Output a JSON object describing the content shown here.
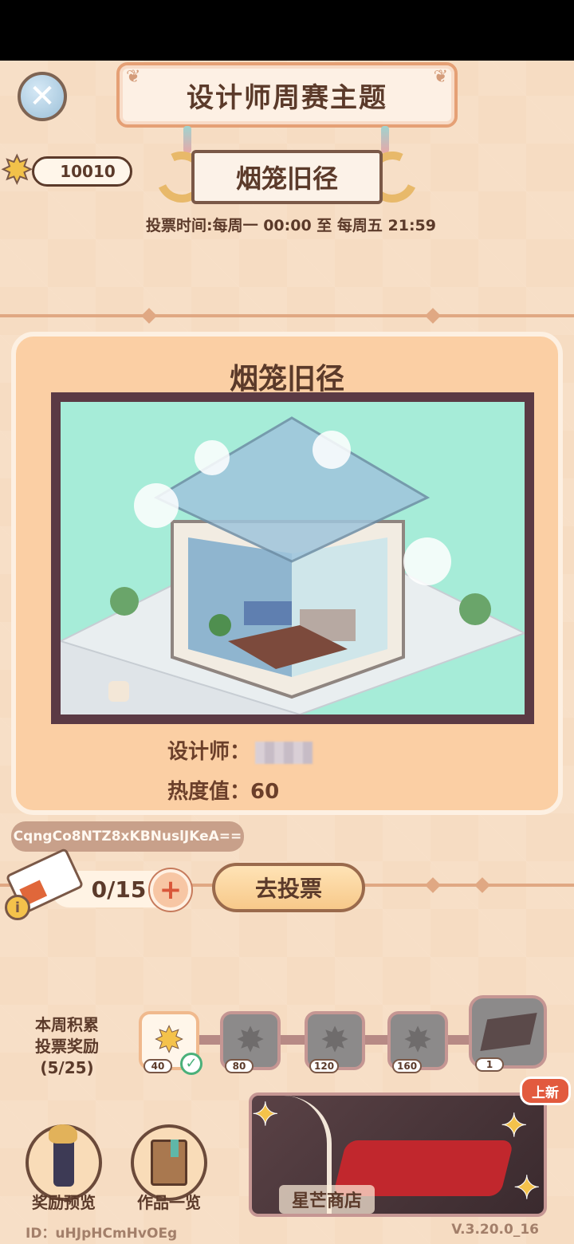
{
  "header": {
    "title": "设计师周赛主题",
    "theme_name": "烟笼旧径",
    "vote_time": "投票时间:每周一 00:00 至 每周五 21:59",
    "close_icon": "close-icon"
  },
  "stars": {
    "count": "10010",
    "icon": "star-icon"
  },
  "entry": {
    "title": "烟笼旧径",
    "designer_label": "设计师：",
    "heat_label": "热度值：",
    "heat_value": "60",
    "code": "CqngCo8NTZ8xKBNuslJKeA=="
  },
  "voting": {
    "tickets": "0/15",
    "plus_symbol": "+",
    "info_symbol": "i",
    "vote_button": "去投票"
  },
  "rewards": {
    "label_line1": "本周积累",
    "label_line2": "投票奖励",
    "label_progress": "(5/25)",
    "tiers": [
      "40",
      "80",
      "120",
      "160"
    ],
    "final_tier": "1",
    "checkmark": "✓"
  },
  "bottom": {
    "reward_preview": "奖励预览",
    "works_list": "作品一览",
    "shop_label": "星芒商店",
    "new_badge": "上新"
  },
  "footer": {
    "id": "ID：uHJpHCmHvOEg",
    "version": "V.3.20.0_16"
  },
  "colors": {
    "background": "#f6dcc2",
    "card": "#fbcfa4",
    "text": "#5b3a2a",
    "accent_red": "#e25a3e",
    "star_gold": "#f4c24b"
  }
}
